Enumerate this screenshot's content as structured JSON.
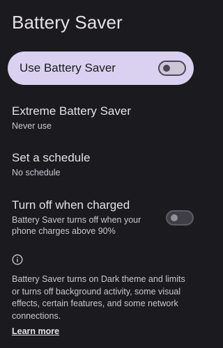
{
  "header": {
    "title": "Battery Saver"
  },
  "main_switch": {
    "label": "Use Battery Saver",
    "state": "off"
  },
  "preferences": [
    {
      "title": "Extreme Battery Saver",
      "summary": "Never use"
    },
    {
      "title": "Set a schedule",
      "summary": "No schedule"
    },
    {
      "title": "Turn off when charged",
      "summary_line1": "Battery Saver turns off when your",
      "summary_line2": "phone charges above 90%",
      "toggle_state": "off"
    }
  ],
  "footer": {
    "icon": "info-icon",
    "line1": "Battery Saver turns on Dark theme and limits",
    "line2": "or turns off background activity, some visual",
    "line3": "effects, certain features, and some network",
    "line4": "connections.",
    "learn_more": "Learn more"
  },
  "colors": {
    "background": "#1b1b1f",
    "main_switch_bg": "#d9d1ef",
    "primary_text": "#e5e1e6",
    "secondary_text": "#c9c5d0"
  }
}
